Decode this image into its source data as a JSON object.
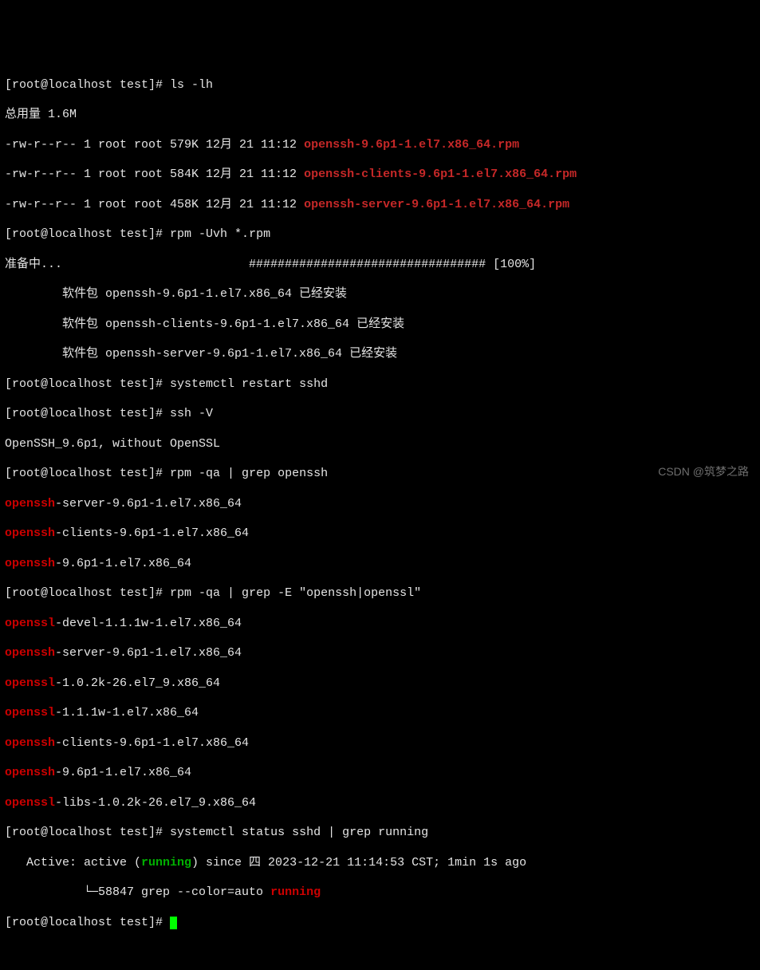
{
  "prompt": "[root@localhost test]# ",
  "cmds": {
    "ls": "ls -lh",
    "rpm_install": "rpm -Uvh *.rpm",
    "restart": "systemctl restart sshd",
    "ssh_v": "ssh -V",
    "rpm_qa1": "rpm -qa | grep openssh",
    "rpm_qa2": "rpm -qa | grep -E \"openssh|openssl\"",
    "status": "systemctl status sshd | grep running"
  },
  "ls_header": "总用量 1.6M",
  "ls_rows": [
    {
      "perm": "-rw-r--r-- 1 root root 579K 12月 21 11:12 ",
      "file": "openssh-9.6p1-1.el7.x86_64.rpm"
    },
    {
      "perm": "-rw-r--r-- 1 root root 584K 12月 21 11:12 ",
      "file": "openssh-clients-9.6p1-1.el7.x86_64.rpm"
    },
    {
      "perm": "-rw-r--r-- 1 root root 458K 12月 21 11:12 ",
      "file": "openssh-server-9.6p1-1.el7.x86_64.rpm"
    }
  ],
  "prepare": "准备中...                          ################################# [100%]",
  "already_installed": [
    "        软件包 openssh-9.6p1-1.el7.x86_64 已经安装",
    "        软件包 openssh-clients-9.6p1-1.el7.x86_64 已经安装",
    "        软件包 openssh-server-9.6p1-1.el7.x86_64 已经安装"
  ],
  "ssh_version": "OpenSSH_9.6p1, without OpenSSL",
  "grep1": [
    {
      "m": "openssh",
      "rest": "-server-9.6p1-1.el7.x86_64"
    },
    {
      "m": "openssh",
      "rest": "-clients-9.6p1-1.el7.x86_64"
    },
    {
      "m": "openssh",
      "rest": "-9.6p1-1.el7.x86_64"
    }
  ],
  "grep2": [
    {
      "m": "openssl",
      "rest": "-devel-1.1.1w-1.el7.x86_64"
    },
    {
      "m": "openssh",
      "rest": "-server-9.6p1-1.el7.x86_64"
    },
    {
      "m": "openssl",
      "rest": "-1.0.2k-26.el7_9.x86_64"
    },
    {
      "m": "openssl",
      "rest": "-1.1.1w-1.el7.x86_64"
    },
    {
      "m": "openssh",
      "rest": "-clients-9.6p1-1.el7.x86_64"
    },
    {
      "m": "openssh",
      "rest": "-9.6p1-1.el7.x86_64"
    },
    {
      "m": "openssl",
      "rest": "-libs-1.0.2k-26.el7_9.x86_64"
    }
  ],
  "status_line": {
    "pre": "   Active: active (",
    "running": "running",
    "post": ") since 四 2023-12-21 11:14:53 CST; 1min 1s ago"
  },
  "grep_proc": {
    "pre": "           └─58847 grep --color=auto ",
    "match": "running"
  },
  "watermark": "CSDN @筑梦之路"
}
